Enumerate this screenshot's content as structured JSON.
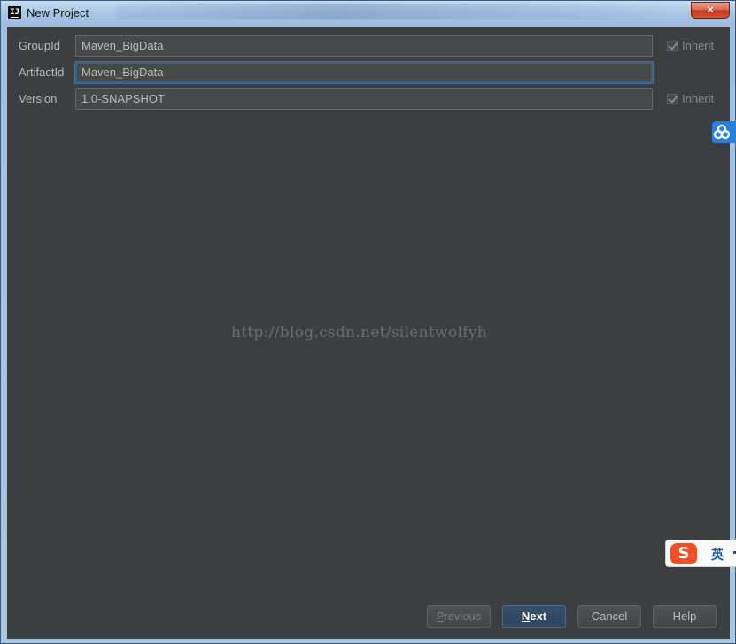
{
  "window": {
    "title": "New Project",
    "close_glyph": "✕",
    "app_icon_text": "IJ"
  },
  "form": {
    "group_id": {
      "label": "GroupId",
      "value": "Maven_BigData",
      "inherit_label": "Inherit",
      "inherit_checked": true
    },
    "artifact_id": {
      "label": "ArtifactId",
      "value": "Maven_BigData"
    },
    "version": {
      "label": "Version",
      "value": "1.0-SNAPSHOT",
      "inherit_label": "Inherit",
      "inherit_checked": true
    }
  },
  "watermark": "http://blog.csdn.net/silentwolfyh",
  "buttons": {
    "previous": {
      "first": "P",
      "rest": "revious"
    },
    "next": {
      "first": "N",
      "rest": "ext"
    },
    "cancel": "Cancel",
    "help": "Help"
  },
  "overlays": {
    "ime_logo": "S",
    "ime_mode": "英"
  },
  "colors": {
    "panel_bg": "#3c3f41",
    "field_bg": "#45494a",
    "focus_border": "#3d6185",
    "default_button_bg": "#2e4560"
  }
}
